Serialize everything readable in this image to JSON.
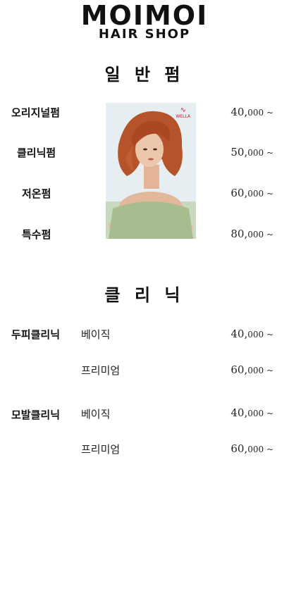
{
  "logo": {
    "main": "MOIMOI",
    "sub": "HAIR SHOP"
  },
  "sections": {
    "perm": {
      "title": "일 반 펌",
      "items": [
        {
          "name": "오리지널펌",
          "price_main": "40,",
          "price_small": "000 ~"
        },
        {
          "name": "클리닉펌",
          "price_main": "50,",
          "price_small": "000 ~"
        },
        {
          "name": "저온펌",
          "price_main": "60,",
          "price_small": "000 ~"
        },
        {
          "name": "특수펌",
          "price_main": "80,",
          "price_small": "000 ~"
        }
      ],
      "photo": {
        "brand": "WELLA",
        "icon": "wella-swirl-icon"
      }
    },
    "clinic": {
      "title": "클 리 닉",
      "groups": [
        {
          "name": "두피클리닉",
          "options": [
            {
              "label": "베이직",
              "price_main": "40,",
              "price_small": "000 ~"
            },
            {
              "label": "프리미엄",
              "price_main": "60,",
              "price_small": "000 ~"
            }
          ]
        },
        {
          "name": "모발클리닉",
          "options": [
            {
              "label": "베이직",
              "price_main": "40,",
              "price_small": "000 ~"
            },
            {
              "label": "프리미엄",
              "price_main": "60,",
              "price_small": "000 ~"
            }
          ]
        }
      ]
    }
  },
  "colors": {
    "text": "#111111",
    "brand_accent": "#c0192c",
    "hair": "#b5532a"
  }
}
